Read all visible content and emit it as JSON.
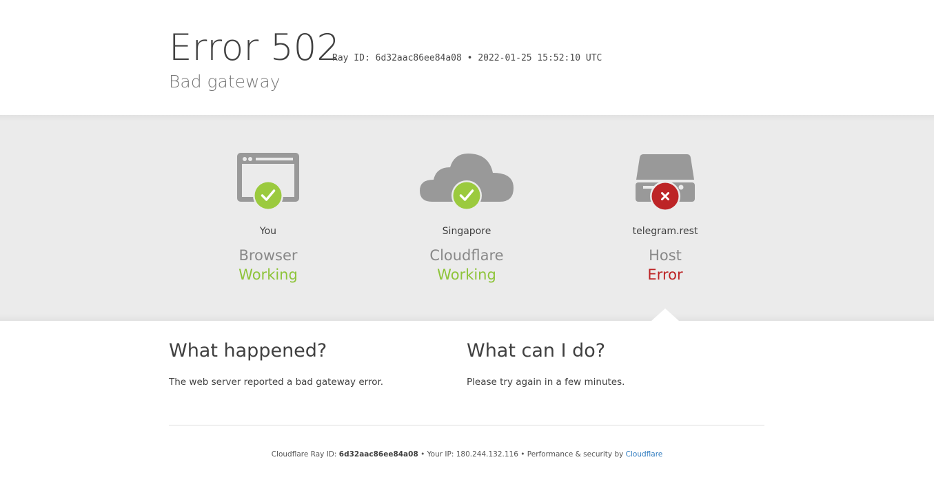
{
  "header": {
    "error_code": "Error 502",
    "ray_label": "Ray ID: 6d32aac86ee84a08 •",
    "timestamp": "2022-01-25 15:52:10 UTC",
    "subtitle": "Bad gateway"
  },
  "status": [
    {
      "location": "You",
      "role": "Browser",
      "state": "Working",
      "icon": "browser-icon",
      "badge": "check"
    },
    {
      "location": "Singapore",
      "role": "Cloudflare",
      "state": "Working",
      "icon": "cloud-icon",
      "badge": "check"
    },
    {
      "location": "telegram.rest",
      "role": "Host",
      "state": "Error",
      "icon": "server-icon",
      "badge": "cross"
    }
  ],
  "info": {
    "what_happened_title": "What happened?",
    "what_happened_text": "The web server reported a bad gateway error.",
    "what_can_i_do_title": "What can I do?",
    "what_can_i_do_text": "Please try again in a few minutes."
  },
  "footer": {
    "ray_prefix": "Cloudflare Ray ID:",
    "ray_id": "6d32aac86ee84a08",
    "sep1": "•",
    "ip_text": "Your IP: 180.244.132.116",
    "sep2": "•",
    "perf_text": "Performance & security by",
    "link_text": "Cloudflare"
  },
  "colors": {
    "ok": "#8ec43a",
    "error": "#bd2426",
    "icon_gray": "#999999",
    "link": "#2f7bbf"
  }
}
